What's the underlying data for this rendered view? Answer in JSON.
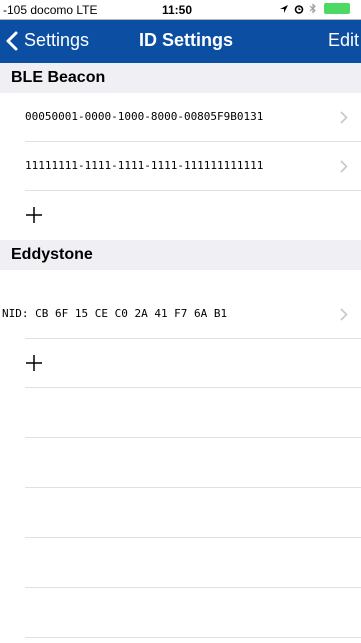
{
  "status_bar": {
    "carrier": "-105 docomo  LTE",
    "time": "11:50",
    "icons": [
      "location-icon",
      "alarm-icon",
      "bluetooth-icon",
      "battery-icon"
    ]
  },
  "nav": {
    "back_label": "Settings",
    "title": "ID Settings",
    "edit_label": "Edit"
  },
  "sections": {
    "ble": {
      "title": "BLE Beacon",
      "items": [
        "00050001-0000-1000-8000-00805F9B0131",
        "11111111-1111-1111-1111-111111111111"
      ]
    },
    "eddystone": {
      "title": "Eddystone",
      "items": [
        "NID: CB 6F 15 CE C0 2A 41 F7 6A B1"
      ]
    }
  },
  "colors": {
    "nav_background": "#0b4ea2",
    "section_background": "#efeff4",
    "battery": "#4cd964"
  }
}
